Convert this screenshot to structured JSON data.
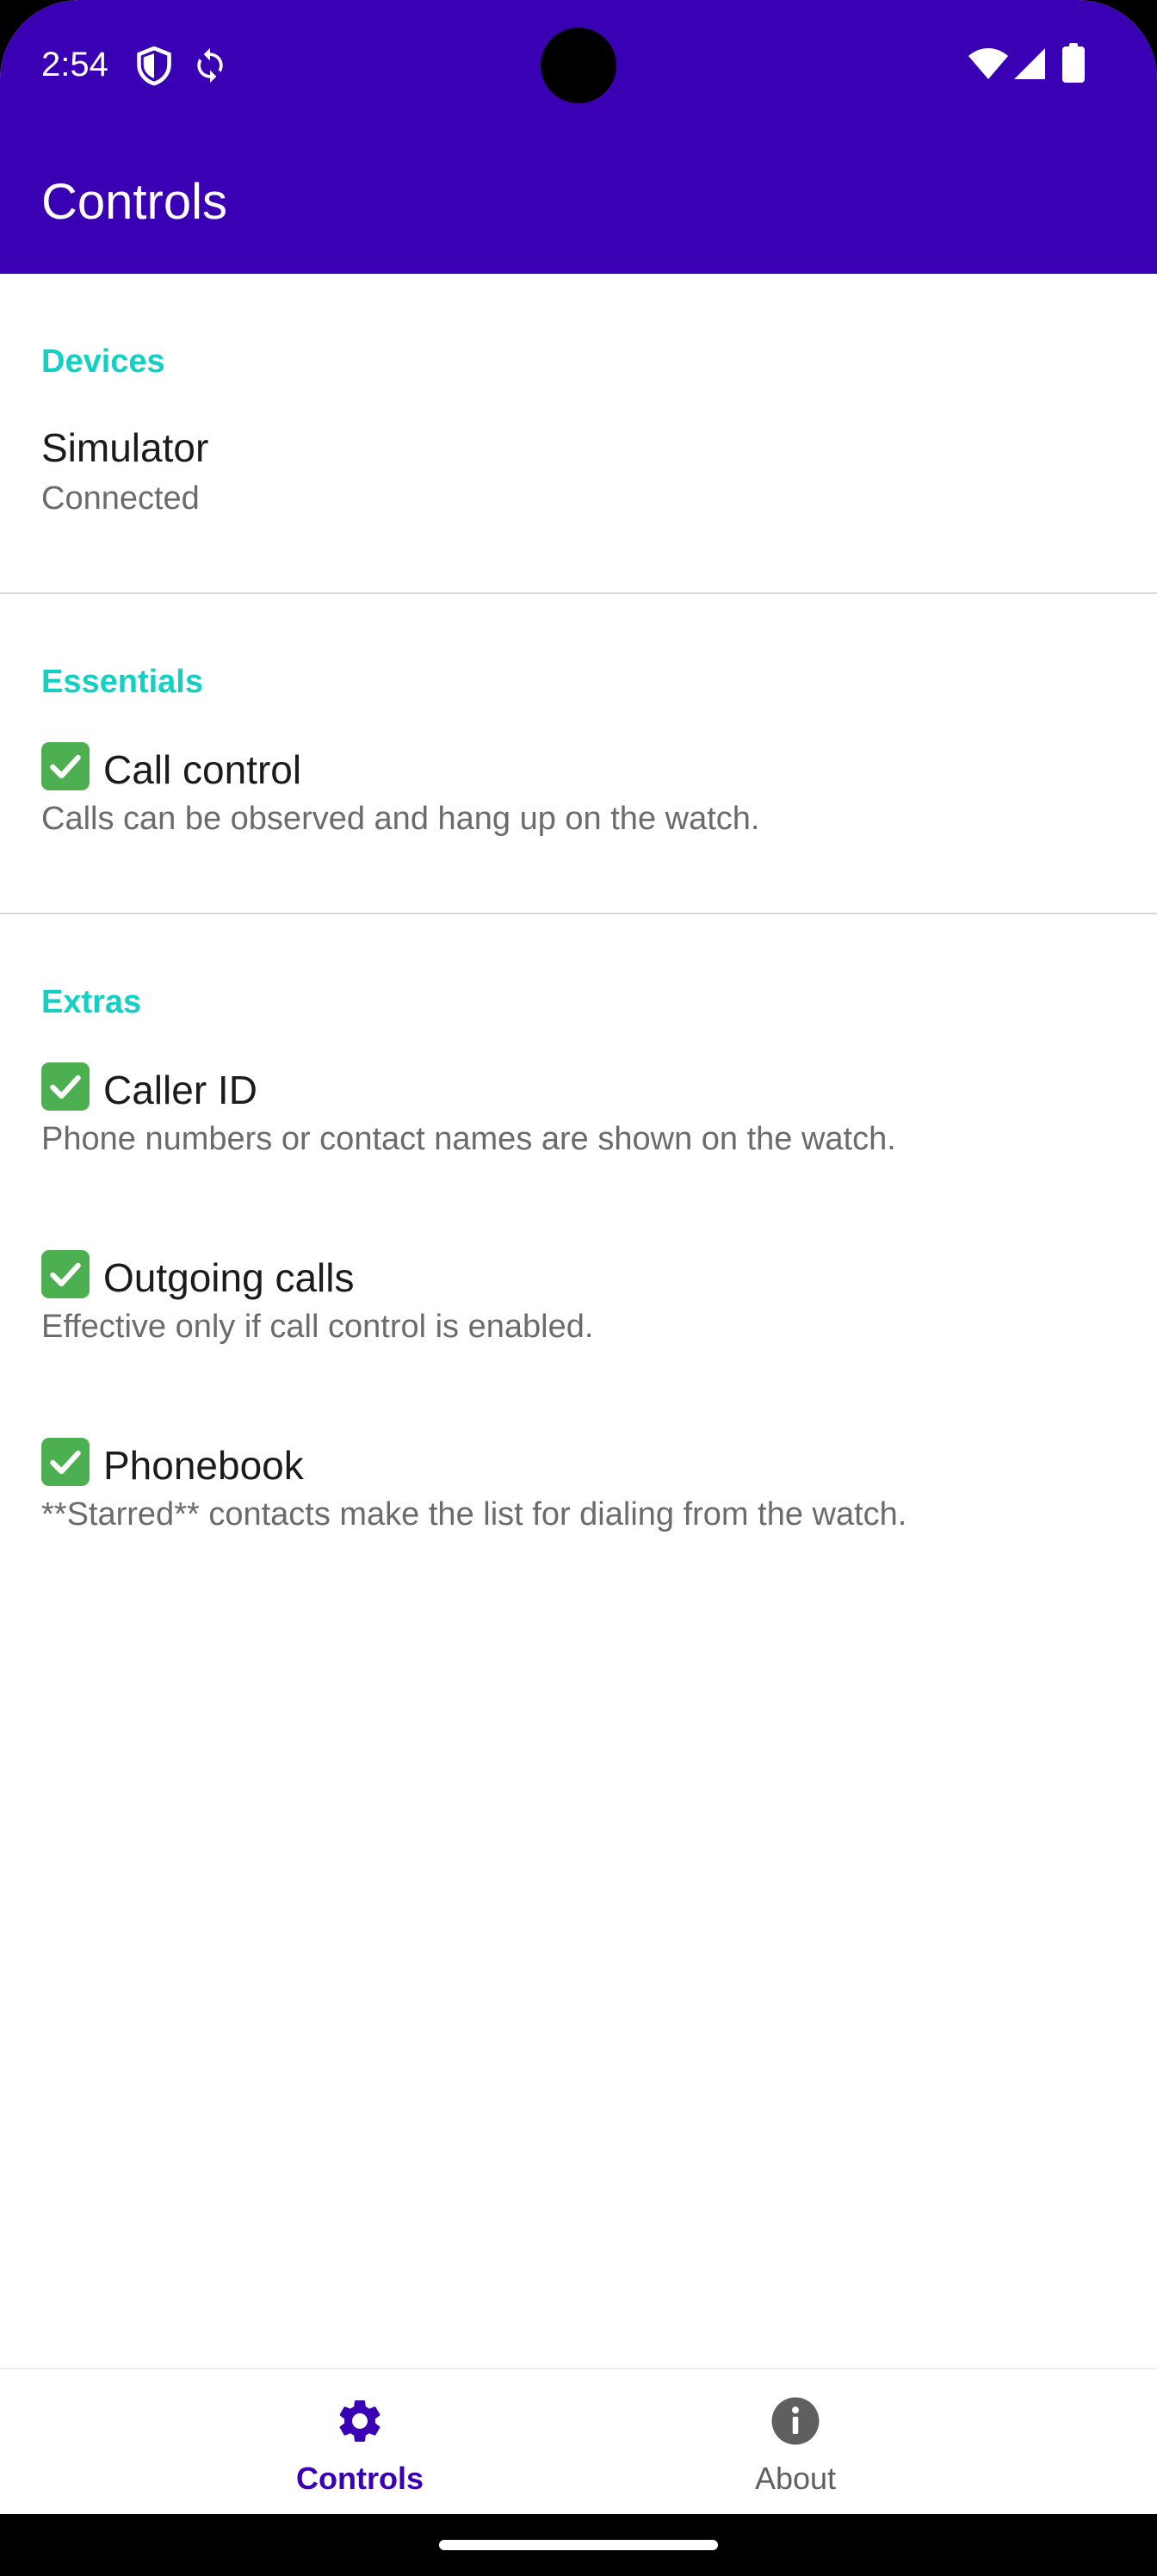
{
  "status_bar": {
    "time": "2:54",
    "icons": [
      "shield-icon",
      "sync-icon",
      "wifi-icon",
      "signal-icon",
      "battery-icon"
    ]
  },
  "app_bar": {
    "title": "Controls"
  },
  "sections": [
    {
      "header": "Devices",
      "items": [
        {
          "title": "Simulator",
          "summary": "Connected",
          "checked": false
        }
      ]
    },
    {
      "header": "Essentials",
      "items": [
        {
          "title": "Call control",
          "summary": "Calls can be observed and hang up on the watch.",
          "checked": true
        }
      ]
    },
    {
      "header": "Extras",
      "items": [
        {
          "title": "Caller ID",
          "summary": "Phone numbers or contact names are shown on the watch.",
          "checked": true
        },
        {
          "title": "Outgoing calls",
          "summary": "Effective only if call control is enabled.",
          "checked": true
        },
        {
          "title": "Phonebook",
          "summary": "**Starred** contacts make the list for dialing from the watch.",
          "checked": true
        }
      ]
    }
  ],
  "bottom_nav": {
    "items": [
      {
        "label": "Controls",
        "icon": "gear-icon",
        "active": true
      },
      {
        "label": "About",
        "icon": "info-icon",
        "active": false
      }
    ]
  },
  "colors": {
    "primary": "#3a00b3",
    "accent": "#13d0c2",
    "check": "#4caf50"
  }
}
